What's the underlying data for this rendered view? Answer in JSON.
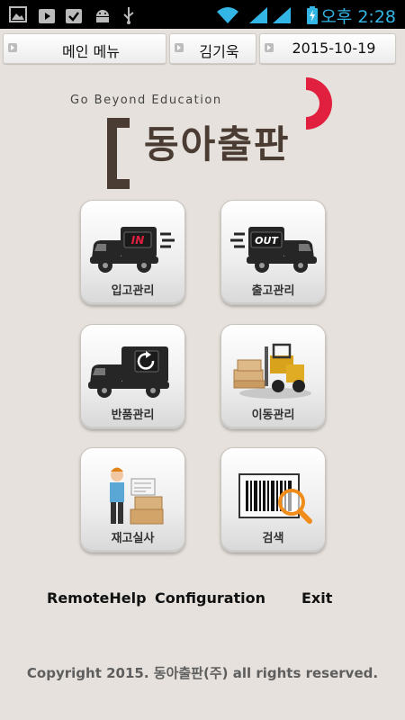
{
  "status": {
    "time": "오후 2:28"
  },
  "topbar": {
    "menu_label": "메인 메뉴",
    "user_label": "김기욱",
    "date_label": "2015-10-19"
  },
  "logo": {
    "tagline": "Go Beyond Education",
    "brand": "동아출판"
  },
  "tiles": [
    {
      "label": "입고관리",
      "badge": "IN"
    },
    {
      "label": "출고관리",
      "badge": "OUT"
    },
    {
      "label": "반품관리"
    },
    {
      "label": "이동관리"
    },
    {
      "label": "재고실사"
    },
    {
      "label": "검색"
    }
  ],
  "footer_links": {
    "remote": "RemoteHelp",
    "config": "Configuration",
    "exit": "Exit"
  },
  "copyright": "Copyright 2015. 동아출판(주) all rights reserved.",
  "colors": {
    "background": "#e6e1dc",
    "brand_red": "#e1203f",
    "brand_brown": "#4a3c32",
    "clock": "#33b5e5"
  }
}
